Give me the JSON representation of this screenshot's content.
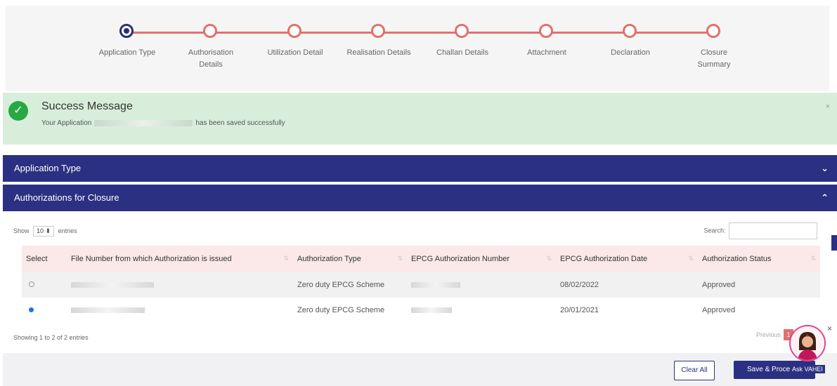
{
  "stepper": {
    "steps": [
      {
        "label": "Application Type"
      },
      {
        "label": "Authorisation Details"
      },
      {
        "label": "Utilization Detail"
      },
      {
        "label": "Realisation Details"
      },
      {
        "label": "Challan Details"
      },
      {
        "label": "Attachment"
      },
      {
        "label": "Declaration"
      },
      {
        "label": "Closure Summary"
      }
    ],
    "active_index": 0
  },
  "success": {
    "title": "Success Message",
    "msg_prefix": "Your Application",
    "msg_suffix": "has been saved successfully",
    "close": "×"
  },
  "sections": {
    "application_type": "Application Type",
    "authorizations": "Authorizations for Closure"
  },
  "table_controls": {
    "show": "Show",
    "page_size": "10",
    "entries": "entries",
    "search": "Search:"
  },
  "table": {
    "headers": [
      "Select",
      "File Number from which Authorization is issued",
      "Authorization Type",
      "EPCG Authorization Number",
      "EPCG Authorization Date",
      "Authorization Status"
    ],
    "rows": [
      {
        "type": "Zero duty EPCG Scheme",
        "date": "08/02/2022",
        "status": "Approved"
      },
      {
        "type": "Zero duty EPCG Scheme",
        "date": "20/01/2021",
        "status": "Approved"
      }
    ]
  },
  "footer_info": "Showing 1 to 2 of 2 entries",
  "pager": {
    "previous": "Previous",
    "page": "1"
  },
  "buttons": {
    "clear": "Clear All",
    "save": "Save & Proceed"
  },
  "bot": {
    "label": "Ask VAHEI",
    "close": "×"
  },
  "colors": {
    "primary": "#2c3082",
    "accent": "#e4706d",
    "success_bg": "#d8eedb"
  }
}
